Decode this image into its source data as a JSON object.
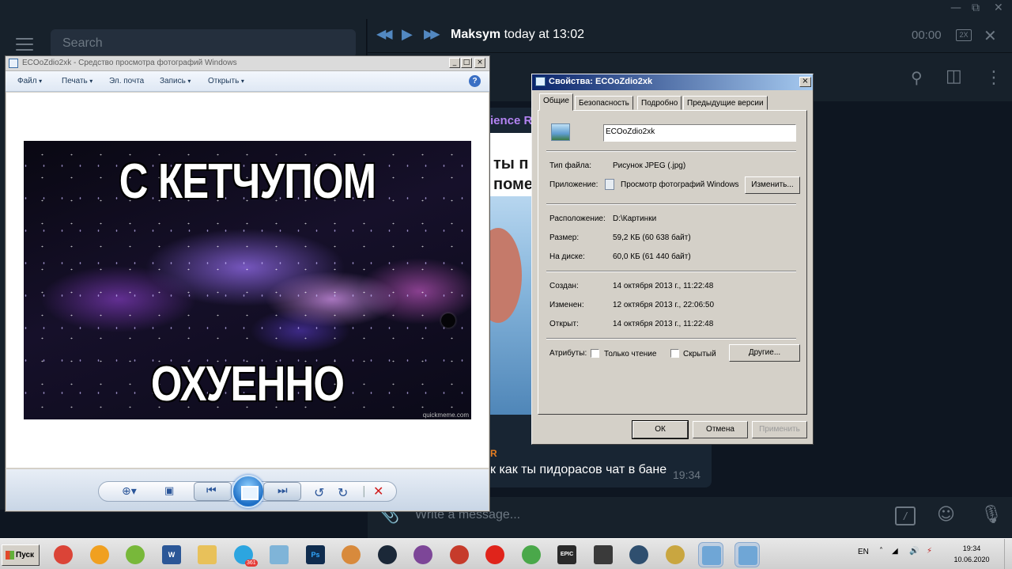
{
  "telegram": {
    "search_placeholder": "Search",
    "player": {
      "prev": "◀◀",
      "play": "▶",
      "next": "▶▶",
      "sender": "Maksym",
      "when": "today at 13:02",
      "time": "00:00",
      "speed": "2X",
      "close": "✕"
    },
    "window_controls": {
      "minimize": "—",
      "maximize": "⧉",
      "close": "✕"
    },
    "header_icons": [
      "search-icon",
      "sidebar-toggle-icon",
      "more-vertical-icon"
    ],
    "message": {
      "name_fragment": "ience Ro",
      "image_text_1": "ты п",
      "image_text_2": "поме",
      "sender_fragment": "R",
      "text": "к как ты пидорасов чат в бане",
      "time": "19:34"
    },
    "compose_placeholder": "Write a message...",
    "compose_icons": [
      "attach-icon",
      "bot-command-icon",
      "emoji-icon",
      "microphone-icon"
    ]
  },
  "photo_viewer": {
    "title": "ECOoZdio2xk - Средство просмотра фотографий Windows",
    "menu": [
      "Файл",
      "Печать",
      "Эл. почта",
      "Запись",
      "Открыть"
    ],
    "meme_top": "С КЕТЧУПОМ",
    "meme_bottom": "ОХУЕННО",
    "watermark": "quickmeme.com"
  },
  "properties": {
    "title": "Свойства: ECOoZdio2xk",
    "tabs": [
      "Общие",
      "Безопасность",
      "Подробно",
      "Предыдущие версии"
    ],
    "filename": "ECOoZdio2xk",
    "file_type_label": "Тип файла:",
    "file_type": "Рисунок JPEG (.jpg)",
    "app_label": "Приложение:",
    "app": "Просмотр фотографий Windows",
    "change_button": "Изменить...",
    "location_label": "Расположение:",
    "location": "D:\\Картинки",
    "size_label": "Размер:",
    "size": "59,2 КБ (60 638 байт)",
    "disk_label": "На диске:",
    "disk": "60,0 КБ (61 440 байт)",
    "created_label": "Создан:",
    "created": "14 октября 2013 г., 11:22:48",
    "modified_label": "Изменен:",
    "modified": "12 октября 2013 г., 22:06:50",
    "opened_label": "Открыт:",
    "opened": "14 октября 2013 г., 11:22:48",
    "attributes_label": "Атрибуты:",
    "readonly": "Только чтение",
    "hidden": "Скрытый",
    "other_button": "Другие...",
    "ok": "ОК",
    "cancel": "Отмена",
    "apply": "Применить"
  },
  "taskbar": {
    "start": "Пуск",
    "apps": [
      {
        "name": "chrome",
        "color": "#db4437"
      },
      {
        "name": "aimp",
        "color": "#f0a020"
      },
      {
        "name": "utorrent",
        "color": "#78b83a"
      },
      {
        "name": "word",
        "color": "#2b5797"
      },
      {
        "name": "explorer",
        "color": "#e8c15a"
      },
      {
        "name": "telegram",
        "color": "#2ca5e0"
      },
      {
        "name": "notepad",
        "color": "#7fb4d8"
      },
      {
        "name": "photoshop",
        "color": "#0f2c4e"
      },
      {
        "name": "paint",
        "color": "#d88a3c"
      },
      {
        "name": "steam",
        "color": "#1b2838"
      },
      {
        "name": "tor-browser",
        "color": "#7d4698"
      },
      {
        "name": "winamp-like",
        "color": "#c63b2b"
      },
      {
        "name": "opera",
        "color": "#e0241b"
      },
      {
        "name": "media",
        "color": "#4aa84a"
      },
      {
        "name": "epic-games",
        "color": "#2a2a2a"
      },
      {
        "name": "monitor",
        "color": "#3a3a3a"
      },
      {
        "name": "vpn",
        "color": "#2f4f6f"
      },
      {
        "name": "settings-gear",
        "color": "#c9a640"
      },
      {
        "name": "photo-viewer-1",
        "color": "#6fa6d6"
      },
      {
        "name": "photo-viewer-2",
        "color": "#6fa6d6"
      }
    ],
    "telegram_badge": "361",
    "epic_label": "EPIC",
    "ps_label": "Ps",
    "word_label": "W",
    "lang": "EN",
    "tray_icons": [
      "show-hidden-icon",
      "network-icon",
      "volume-icon",
      "power-icon"
    ],
    "time": "19:34",
    "date": "10.06.2020"
  }
}
